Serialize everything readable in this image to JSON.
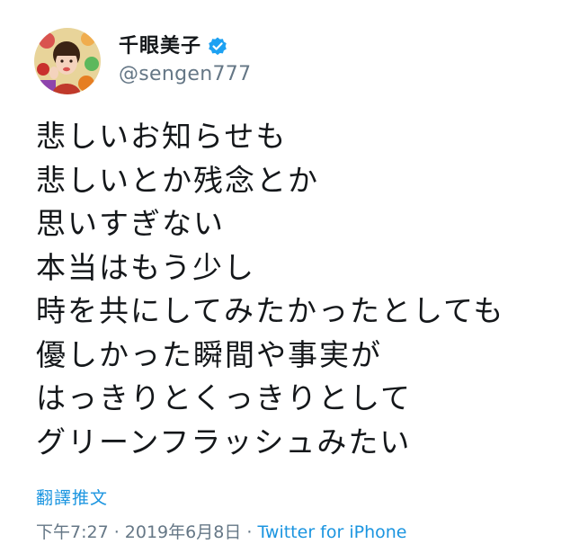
{
  "user": {
    "display_name": "千眼美子",
    "handle": "@sengen777",
    "verified": true,
    "avatar_icon": "profile-avatar"
  },
  "tweet": {
    "lines": [
      "悲しいお知らせも",
      "悲しいとか残念とか",
      "思いすぎない",
      "本当はもう少し",
      "時を共にしてみたかったとしても",
      "優しかった瞬間や事実が",
      "はっきりとくっきりとして",
      "グリーンフラッシュみたい"
    ]
  },
  "translate_label": "翻譯推文",
  "meta": {
    "time": "下午7:27",
    "separator": " · ",
    "date": "2019年6月8日",
    "source": "Twitter for iPhone"
  },
  "colors": {
    "text": "#14171a",
    "secondary": "#657786",
    "link": "#1b95e0",
    "verified_badge": "#1da1f2"
  }
}
